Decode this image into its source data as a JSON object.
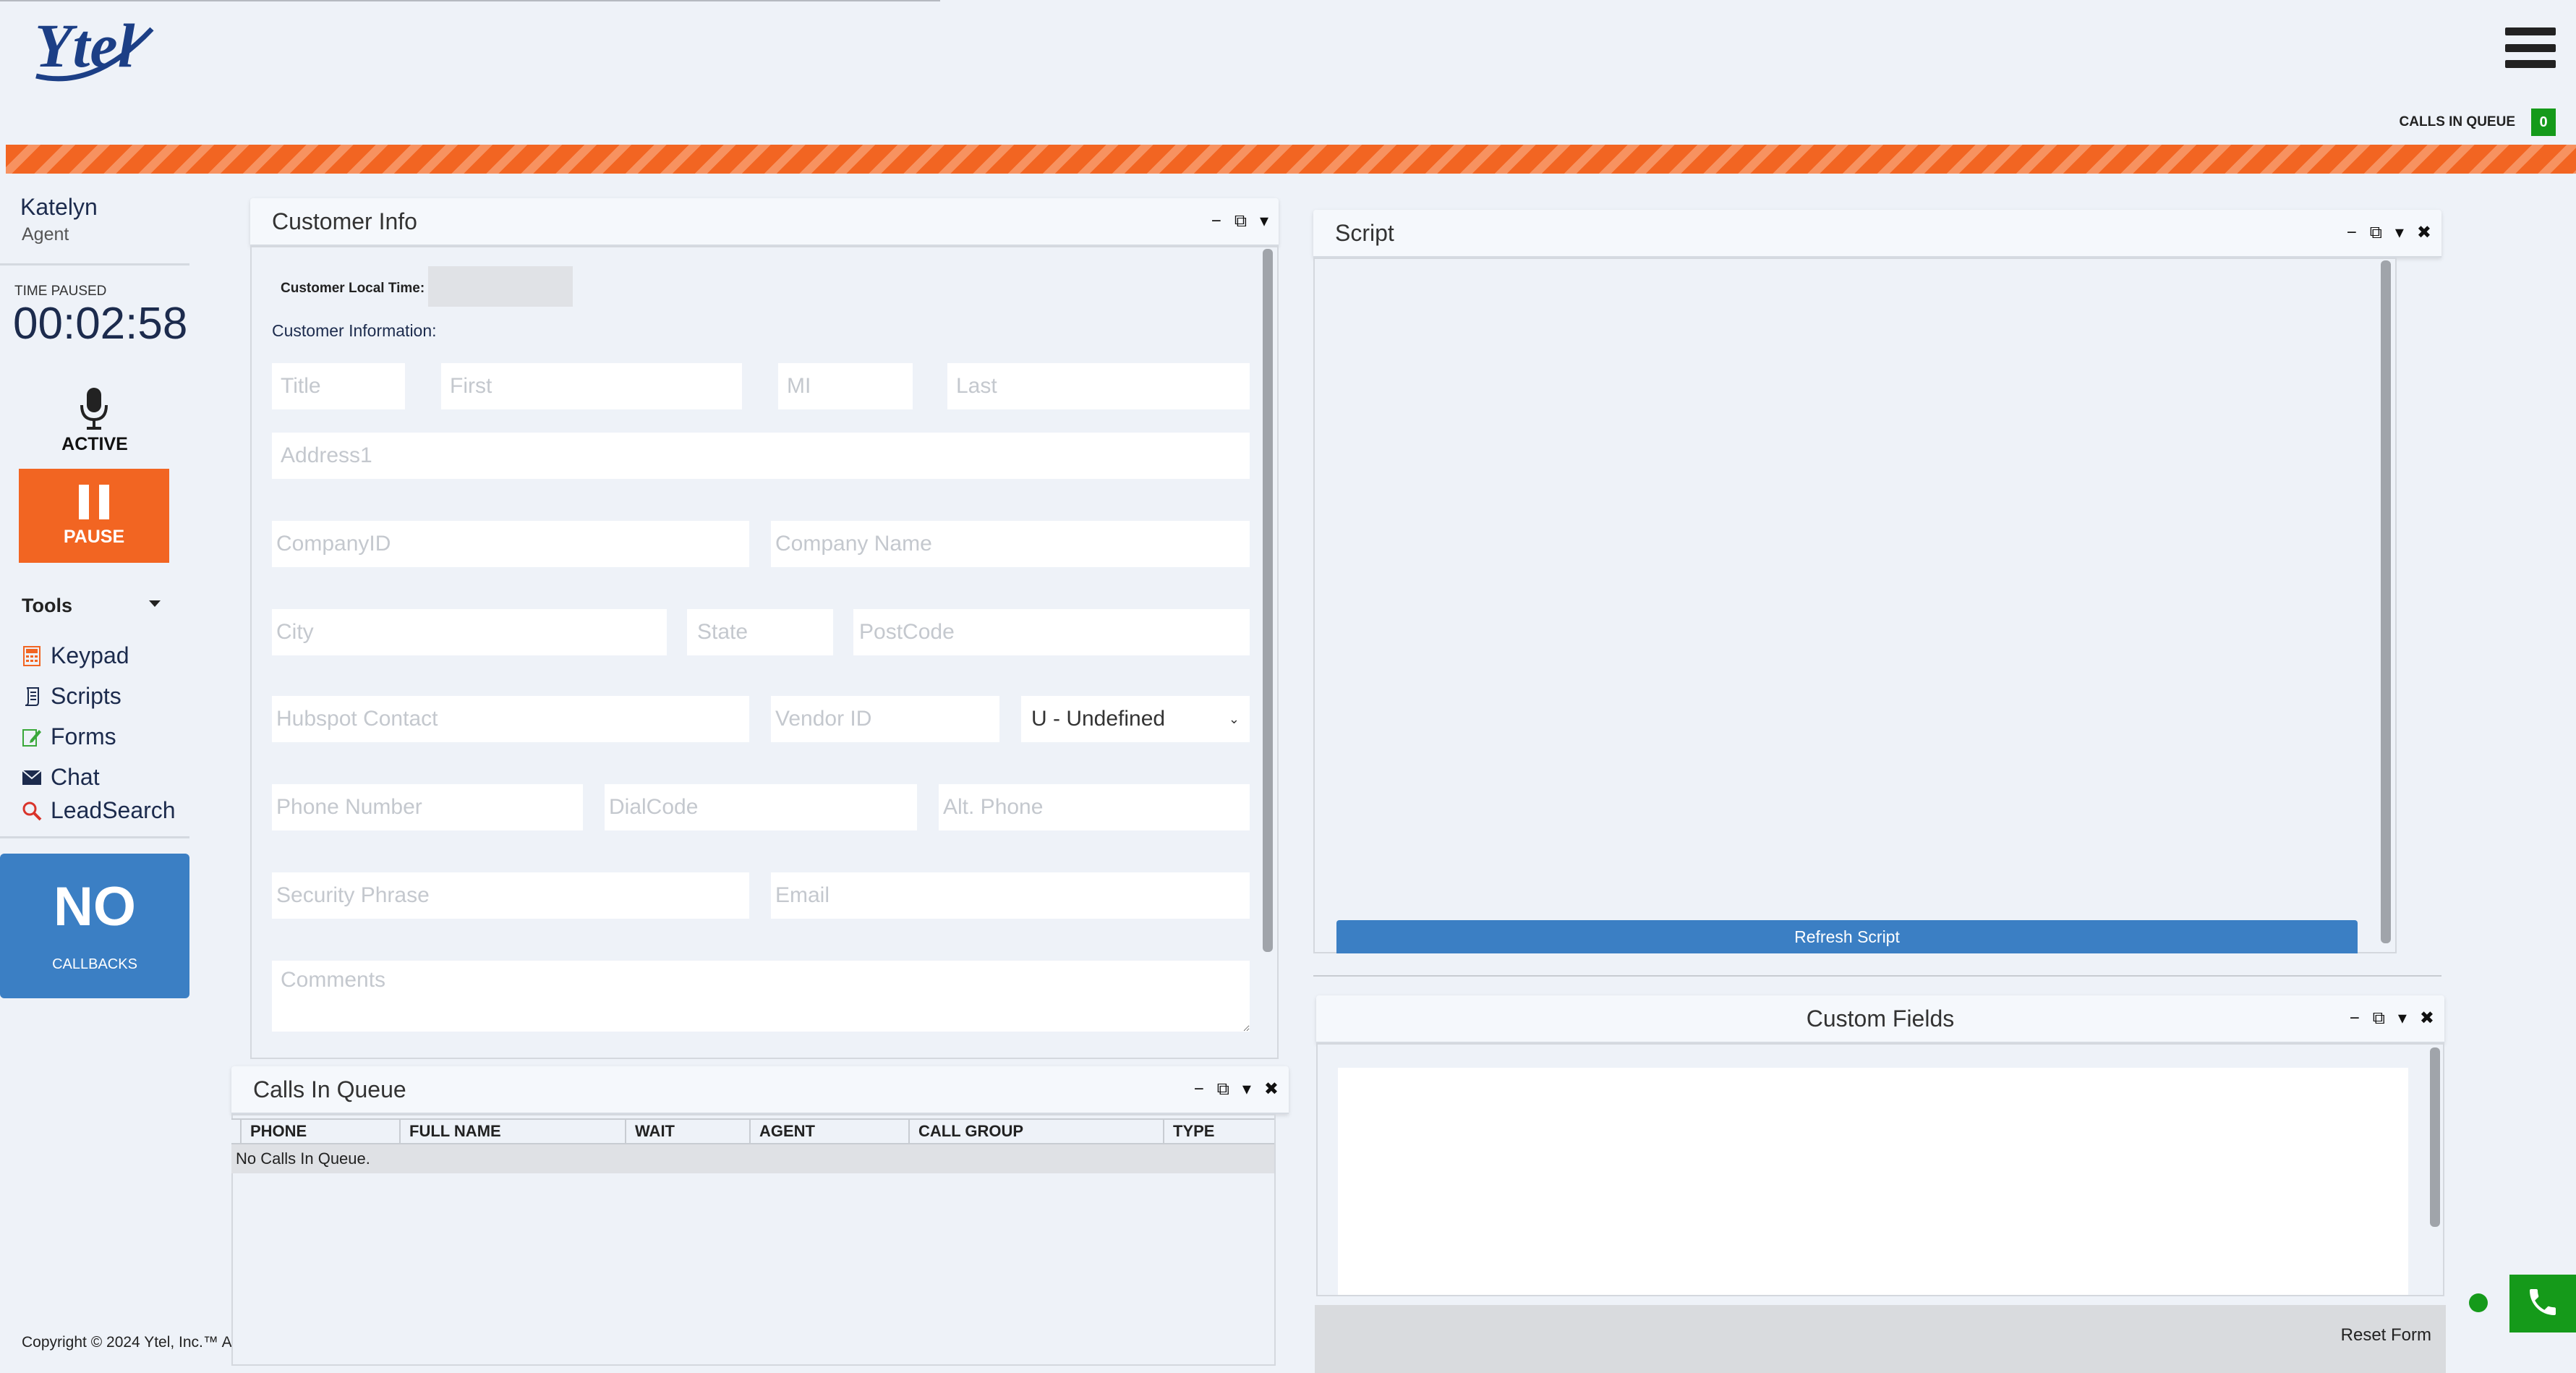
{
  "brand": {
    "logo_text": "Ytel"
  },
  "header": {
    "calls_in_queue_label": "CALLS IN QUEUE",
    "calls_in_queue_count": "0"
  },
  "agent": {
    "name": "Katelyn",
    "role": "Agent"
  },
  "status": {
    "time_label": "TIME PAUSED",
    "time_value": "00:02:58",
    "mic_label": "ACTIVE",
    "pause_label": "PAUSE"
  },
  "tools": {
    "label": "Tools",
    "items": [
      {
        "label": "Keypad",
        "icon": "calculator-icon"
      },
      {
        "label": "Scripts",
        "icon": "scroll-icon"
      },
      {
        "label": "Forms",
        "icon": "form-icon"
      },
      {
        "label": "Chat",
        "icon": "envelope-icon"
      },
      {
        "label": "LeadSearch",
        "icon": "search-icon"
      }
    ]
  },
  "callbacks": {
    "big": "NO",
    "small": "CALLBACKS"
  },
  "footer": {
    "copyright": "Copyright © 2024 Ytel, Inc.™ A"
  },
  "customer_info": {
    "title": "Customer Info",
    "local_time_label": "Customer Local Time:",
    "local_time_value": "",
    "section_label": "Customer Information:",
    "placeholders": {
      "title": "Title",
      "first": "First",
      "mi": "MI",
      "last": "Last",
      "address1": "Address1",
      "company_id": "CompanyID",
      "company_name": "Company Name",
      "city": "City",
      "state": "State",
      "postcode": "PostCode",
      "hubspot": "Hubspot Contact",
      "vendor_id": "Vendor ID",
      "phone": "Phone Number",
      "dialcode": "DialCode",
      "alt_phone": "Alt. Phone",
      "security": "Security Phrase",
      "email": "Email",
      "comments": "Comments"
    },
    "gender_select": "U - Undefined"
  },
  "script_panel": {
    "title": "Script",
    "refresh_label": "Refresh Script"
  },
  "custom_fields": {
    "title": "Custom Fields",
    "reset_label": "Reset Form"
  },
  "calls_queue_panel": {
    "title": "Calls In Queue",
    "columns": [
      "PHONE",
      "FULL NAME",
      "WAIT",
      "AGENT",
      "CALL GROUP",
      "TYPE"
    ],
    "empty_text": "No Calls In Queue."
  },
  "panel_controls": {
    "minimize": "−",
    "popout": "⧉",
    "menu": "▾",
    "close": "✖"
  },
  "colors": {
    "accent": "#f26522",
    "blue": "#3b7fc4",
    "green": "#159a1a",
    "navy": "#1c2b4d"
  }
}
